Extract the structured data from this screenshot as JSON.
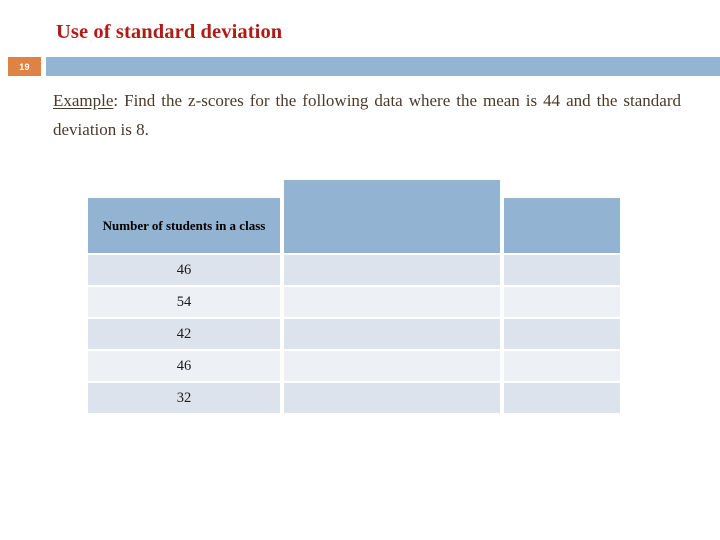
{
  "slide": {
    "title": "Use of standard deviation",
    "number": "19",
    "accent_orange": "#df8245",
    "accent_blue": "#93b4d3",
    "title_color": "#b21a17",
    "body_color": "#4b3a2a"
  },
  "body": {
    "lead": "Example",
    "after_lead": ": Find the z-scores for the following data where the mean is 44 and the standard deviation is 8."
  },
  "table": {
    "headers": [
      "Number of students in a class",
      "",
      ""
    ],
    "rows": [
      {
        "students": "46",
        "col2": "",
        "col3": ""
      },
      {
        "students": "54",
        "col2": "",
        "col3": ""
      },
      {
        "students": "42",
        "col2": "",
        "col3": ""
      },
      {
        "students": "46",
        "col2": "",
        "col3": ""
      },
      {
        "students": "32",
        "col2": "",
        "col3": ""
      }
    ],
    "header_fill": "#92b4d2",
    "row_fill_a": "#dce3ec",
    "row_fill_b": "#edf0f5"
  }
}
